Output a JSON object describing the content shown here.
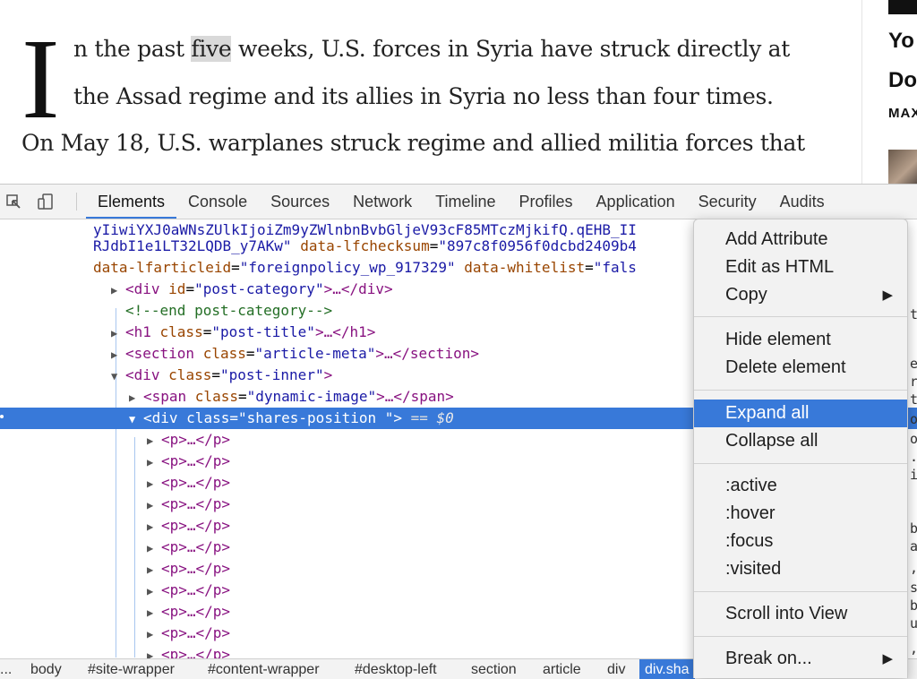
{
  "article": {
    "dropcap": "I",
    "line1_pre": "n the past ",
    "line1_hl": "five",
    "line1_post": " weeks, U.S. forces in Syria have struck directly at",
    "line2": "the Assad regime and its allies in Syria no less than four times.",
    "line3": "On May 18, U.S. warplanes struck regime and allied militia forces that"
  },
  "sidebar": {
    "line1": "Yo",
    "line2": "Do",
    "author": "MAX"
  },
  "devtools": {
    "tabs": [
      "Elements",
      "Console",
      "Sources",
      "Network",
      "Timeline",
      "Profiles",
      "Application",
      "Security",
      "Audits"
    ],
    "active_tab": "Elements",
    "dom": {
      "row0": "yIiwiYXJ0aWNsZUlkIjoiZm9yZWlnbnBvbGljeV93cF85MTczMjkifQ.qEHB_II",
      "row1_val": "RJdbI1e1LT32LQDB_y7AKw\"",
      "row1_attr": "data-lfchecksum",
      "row1_attr_val": "\"897c8f0956f0dcbd2409b4",
      "row2_attr": "data-lfarticleid",
      "row2_val": "\"foreignpolicy_wp_917329\"",
      "row2_attr2": "data-whitelist",
      "row2_val2": "\"fals",
      "row3": {
        "tag_open": "<div ",
        "attr": "id",
        "val": "\"post-category\"",
        "rest": ">…</div>"
      },
      "row4": "<!--end post-category-->",
      "row5": {
        "tag_open": "<h1 ",
        "attr": "class",
        "val": "\"post-title\"",
        "rest": ">…</h1>"
      },
      "row6": {
        "tag_open": "<section ",
        "attr": "class",
        "val": "\"article-meta\"",
        "rest": ">…</section>"
      },
      "row7": {
        "tag_open": "<div ",
        "attr": "class",
        "val": "\"post-inner\"",
        "rest": ">"
      },
      "row8": {
        "tag_open": "<span ",
        "attr": "class",
        "val": "\"dynamic-image\"",
        "rest": ">…</span>"
      },
      "row9": {
        "tag_open": "<div ",
        "attr": "class",
        "val": "\"shares-position \"",
        "rest": ">",
        "eq": " == ",
        "ref": "$0"
      },
      "p_row": "<p>…</p>",
      "p_partial": "<p>…</p>"
    },
    "right_snips": [
      "t",
      "e",
      "r",
      "t",
      "o",
      "o",
      ".",
      "i",
      "b",
      "a",
      ",",
      "s",
      "b",
      "u",
      ","
    ],
    "breadcrumbs": [
      "...",
      "body",
      "#site-wrapper",
      "#content-wrapper",
      "#desktop-left",
      "section",
      "article",
      "div",
      "div.sha"
    ],
    "active_crumb": "div.sha"
  },
  "context_menu": {
    "items": [
      "Add Attribute",
      "Edit as HTML",
      "Copy",
      "Hide element",
      "Delete element",
      "Expand all",
      "Collapse all",
      ":active",
      ":hover",
      ":focus",
      ":visited",
      "Scroll into View",
      "Break on..."
    ],
    "highlighted": "Expand all",
    "submenu_arrow": "▶"
  },
  "colors": {
    "selection": "#3879d9",
    "tag": "#881280",
    "attr_name": "#994500",
    "attr_value": "#1a1aa6",
    "comment": "#236e25"
  }
}
